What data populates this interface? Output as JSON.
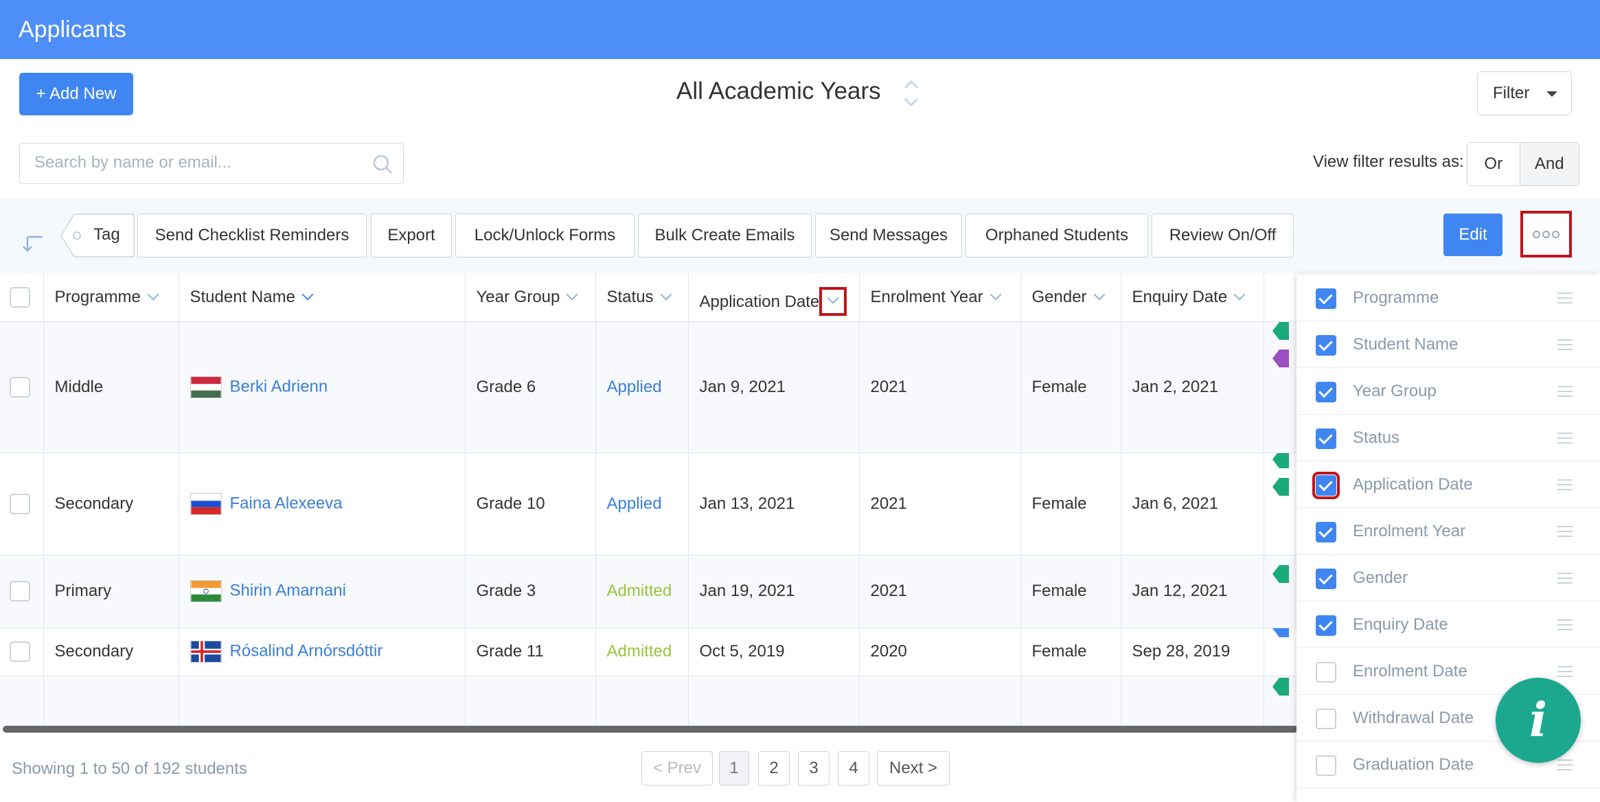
{
  "header": {
    "title": "Applicants"
  },
  "actions": {
    "add_new": "+ Add New",
    "academic_year": "All Academic Years",
    "filter": "Filter"
  },
  "search": {
    "placeholder": "Search by name or email..."
  },
  "view_filter": {
    "label": "View filter results as:",
    "or": "Or",
    "and": "And"
  },
  "toolbar": {
    "tag": "Tag",
    "buttons": [
      "Send Checklist Reminders",
      "Export",
      "Lock/Unlock Forms",
      "Bulk Create Emails",
      "Send Messages",
      "Orphaned Students",
      "Review On/Off"
    ],
    "edit": "Edit"
  },
  "table": {
    "columns": [
      "Programme",
      "Student Name",
      "Year Group",
      "Status",
      "Application Date",
      "Enrolment Year",
      "Gender",
      "Enquiry Date"
    ],
    "rows": [
      {
        "programme": "Middle",
        "name": "Berki Adrienn",
        "flag": "hungary",
        "year_group": "Grade 6",
        "status": "Applied",
        "application_date": "Jan 9, 2021",
        "enrolment_year": "2021",
        "gender": "Female",
        "enquiry_date": "Jan 2, 2021"
      },
      {
        "programme": "Secondary",
        "name": "Faina Alexeeva",
        "flag": "russia",
        "year_group": "Grade 10",
        "status": "Applied",
        "application_date": "Jan 13, 2021",
        "enrolment_year": "2021",
        "gender": "Female",
        "enquiry_date": "Jan 6, 2021"
      },
      {
        "programme": "Primary",
        "name": "Shirin Amarnani",
        "flag": "india",
        "year_group": "Grade 3",
        "status": "Admitted",
        "application_date": "Jan 19, 2021",
        "enrolment_year": "2021",
        "gender": "Female",
        "enquiry_date": "Jan 12, 2021"
      },
      {
        "programme": "Secondary",
        "name": "Rósalind Arnórsdóttir",
        "flag": "iceland",
        "year_group": "Grade 11",
        "status": "Admitted",
        "application_date": "Oct 5, 2019",
        "enrolment_year": "2020",
        "gender": "Female",
        "enquiry_date": "Sep 28, 2019"
      }
    ]
  },
  "colors": {
    "header": "#4d8ef8",
    "primary": "#3f86f2",
    "applied": "#3a7fd8",
    "admitted": "#9bc53d",
    "highlight": "#c0141a",
    "info": "#1ba88f"
  },
  "footer": {
    "showing": "Showing 1 to 50 of 192 students",
    "prev": "< Prev",
    "pages": [
      "1",
      "2",
      "3",
      "4"
    ],
    "next": "Next >"
  },
  "column_panel": {
    "items": [
      {
        "label": "Programme",
        "checked": true
      },
      {
        "label": "Student Name",
        "checked": true
      },
      {
        "label": "Year Group",
        "checked": true
      },
      {
        "label": "Status",
        "checked": true
      },
      {
        "label": "Application Date",
        "checked": true
      },
      {
        "label": "Enrolment Year",
        "checked": true
      },
      {
        "label": "Gender",
        "checked": true
      },
      {
        "label": "Enquiry Date",
        "checked": true
      },
      {
        "label": "Enrolment Date",
        "checked": false
      },
      {
        "label": "Withdrawal Date",
        "checked": false
      },
      {
        "label": "Graduation Date",
        "checked": false
      }
    ]
  },
  "info_button": {
    "label": "i"
  }
}
